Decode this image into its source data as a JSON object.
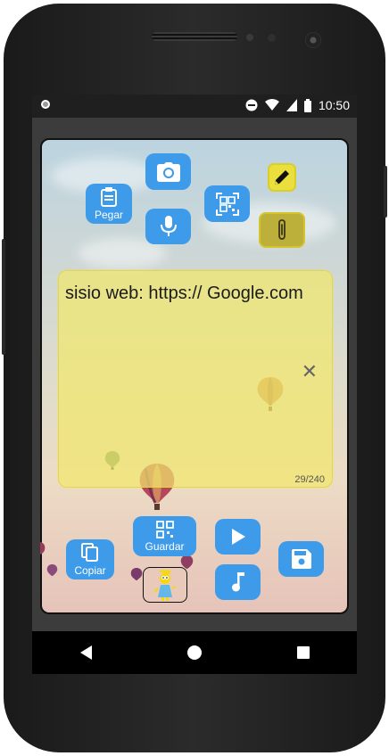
{
  "status_bar": {
    "time": "10:50",
    "icons": [
      "do-not-disturb-icon",
      "wifi-icon",
      "signal-icon",
      "battery-icon"
    ]
  },
  "toolbar": {
    "camera_icon": "camera-icon",
    "paste_label": "Pegar",
    "qr_scan_icon": "qr-scan-icon",
    "edit_icon": "pencil-icon",
    "mic_icon": "microphone-icon",
    "attach_icon": "paperclip-icon"
  },
  "note": {
    "text": "sisio web: https:// Google.com",
    "char_count": "29/240",
    "close_symbol": "✕"
  },
  "bottom_actions": {
    "copy_label": "Copiar",
    "save_qr_label": "Guardar",
    "play_icon": "play-icon",
    "music_icon": "music-icon",
    "save_icon": "floppy-disk-icon",
    "avatar_icon": "cartoon-avatar-icon"
  },
  "colors": {
    "accent_button": "#3d9be9",
    "note_background": "#f1e86c",
    "edit_button": "#eadf3c"
  },
  "navigation": {
    "back_icon": "back-triangle-icon",
    "home_icon": "home-circle-icon",
    "recents_icon": "recents-square-icon"
  }
}
